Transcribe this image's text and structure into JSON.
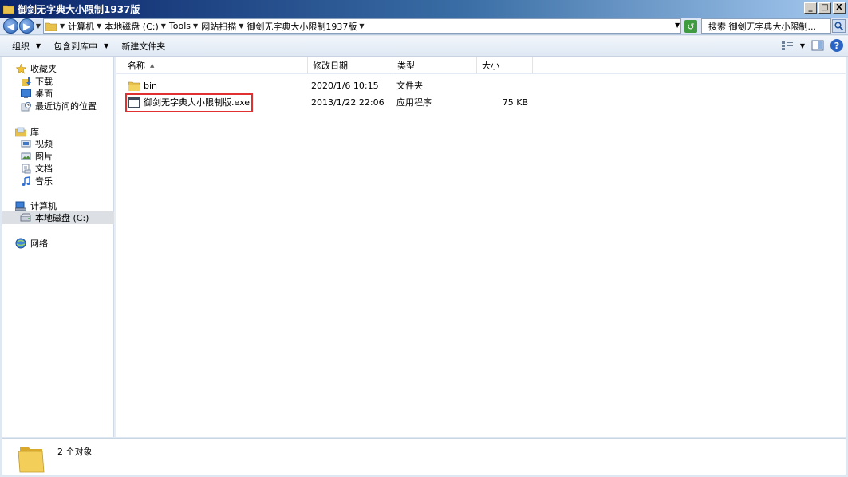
{
  "window": {
    "title": "御剑无字典大小限制1937版",
    "controls": {
      "minimize": "_",
      "maximize": "□",
      "close": "X"
    }
  },
  "address": {
    "breadcrumbs": [
      "计算机",
      "本地磁盘 (C:)",
      "Tools",
      "网站扫描",
      "御剑无字典大小限制1937版"
    ],
    "search_placeholder": "搜索 御剑无字典大小限制..."
  },
  "toolbar": {
    "organize": "组织",
    "include_in_library": "包含到库中",
    "new_folder": "新建文件夹"
  },
  "nav": {
    "favorites": {
      "label": "收藏夹",
      "items": [
        "下载",
        "桌面",
        "最近访问的位置"
      ]
    },
    "libraries": {
      "label": "库",
      "items": [
        "视频",
        "图片",
        "文档",
        "音乐"
      ]
    },
    "computer": {
      "label": "计算机",
      "items": [
        "本地磁盘 (C:)"
      ]
    },
    "network": {
      "label": "网络"
    }
  },
  "columns": [
    "名称",
    "修改日期",
    "类型",
    "大小"
  ],
  "files": [
    {
      "name": "bin",
      "modified": "2020/1/6 10:15",
      "type": "文件夹",
      "size": "",
      "icon": "folder-icon"
    },
    {
      "name": "御剑无字典大小限制版.exe",
      "modified": "2013/1/22 22:06",
      "type": "应用程序",
      "size": "75 KB",
      "icon": "application-icon"
    }
  ],
  "status": {
    "count": "2 个对象"
  },
  "colors": {
    "title_bar": "#0a246a",
    "highlight": "#e03030",
    "selection": "#dcdfe3"
  }
}
